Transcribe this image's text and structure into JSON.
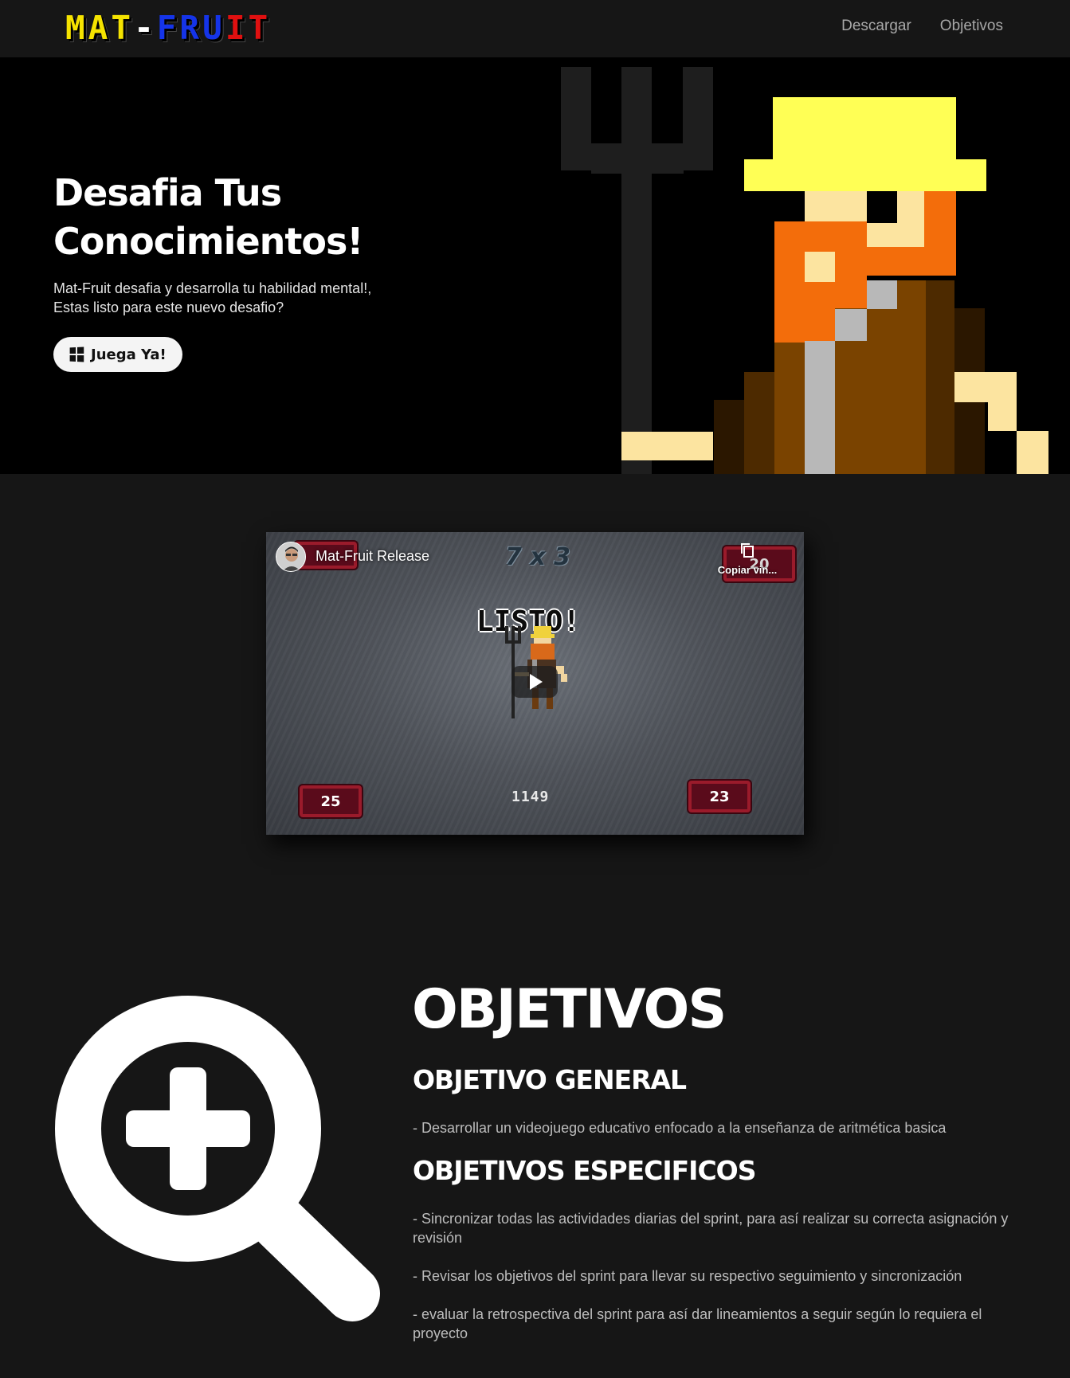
{
  "brand": {
    "logo_parts": [
      {
        "text": "MAT",
        "color": "#f5e300"
      },
      {
        "text": "-",
        "color": "#ffffff"
      },
      {
        "text": "FRU",
        "color": "#1534e8"
      },
      {
        "text": "IT",
        "color": "#e01010"
      }
    ]
  },
  "nav": {
    "links": [
      "Descargar",
      "Objetivos"
    ]
  },
  "hero": {
    "title_line1": "Desafia Tus",
    "title_line2": "Conocimientos!",
    "text_line1": "Mat-Fruit desafia y desarrolla tu habilidad mental!,",
    "text_line2": "Estas listo para este nuevo desafio?",
    "button_label": "Juega Ya!",
    "button_icon": "windows-icon"
  },
  "video": {
    "title": "Mat-Fruit Release",
    "copy_label": "Copiar vin...",
    "equation": "7 x 3",
    "status": "LISTO!",
    "top_right_score": "20",
    "bottom_left_score": "25",
    "bottom_right_score": "23",
    "center_score": "1149"
  },
  "objetivos": {
    "heading": "OBJETIVOS",
    "general_title": "OBJETIVO GENERAL",
    "general_text": "- Desarrollar un videojuego educativo enfocado a la enseñanza de aritmética basica",
    "specific_title": "OBJETIVOS ESPECIFICOS",
    "specific_items": [
      "- Sincronizar todas las actividades diarias del sprint, para así realizar su correcta asignación y revisión",
      "- Revisar los objetivos del sprint para llevar su respectivo seguimiento y sincronización",
      "- evaluar la retrospectiva del sprint para así dar lineamientos a seguir según lo requiera el proyecto"
    ],
    "icon": "zoom-in-icon"
  }
}
